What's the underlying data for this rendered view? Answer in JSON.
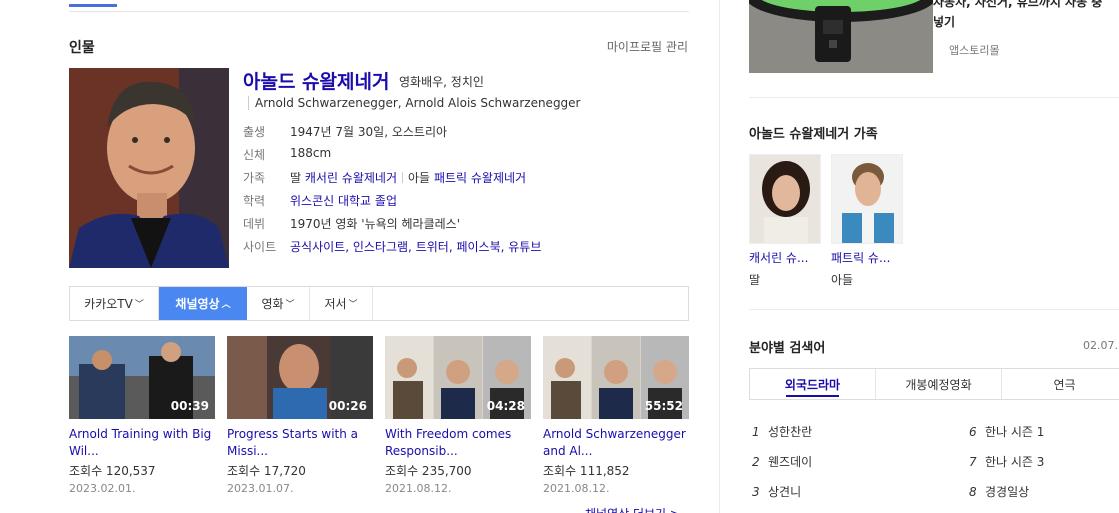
{
  "person": {
    "section_title": "인물",
    "manage_link": "마이프로필 관리",
    "name": "아놀드 슈왈제네거",
    "roles": "영화배우, 정치인",
    "alias": "Arnold Schwarzenegger, Arnold Alois Schwarzenegger",
    "info": {
      "birth_label": "출생",
      "birth_value": "1947년 7월 30일, 오스트리아",
      "height_label": "신체",
      "height_value": "188cm",
      "family_label": "가족",
      "family_daughter_prefix": "딸",
      "family_daughter": "캐서린 슈왈제네거",
      "family_son_prefix": "아들",
      "family_son": "패트릭 슈왈제네거",
      "edu_label": "학력",
      "edu_value": "위스콘신 대학교 졸업",
      "debut_label": "데뷔",
      "debut_value": "1970년 영화 '뉴욕의 헤라클레스'",
      "site_label": "사이트",
      "sites": [
        "공식사이트",
        "인스타그램",
        "트위터",
        "페이스북",
        "유튜브"
      ]
    }
  },
  "tabs": [
    {
      "label": "카카오TV",
      "chevron": "﹀"
    },
    {
      "label": "채널영상",
      "chevron": "︿"
    },
    {
      "label": "영화",
      "chevron": "﹀"
    },
    {
      "label": "저서",
      "chevron": "﹀"
    }
  ],
  "videos": [
    {
      "title": "Arnold Training with Big Wil...",
      "views": "조회수 120,537",
      "date": "2023.02.01.",
      "duration": "00:39"
    },
    {
      "title": "Progress Starts with a Missi...",
      "views": "조회수 17,720",
      "date": "2023.01.07.",
      "duration": "00:26"
    },
    {
      "title": "With Freedom comes Responsib...",
      "views": "조회수 235,700",
      "date": "2021.08.12.",
      "duration": "04:28"
    },
    {
      "title": "Arnold Schwarzenegger and Al...",
      "views": "조회수 111,852",
      "date": "2021.08.12.",
      "duration": "55:52"
    }
  ],
  "more_videos": "채널영상 더보기 >",
  "ad": {
    "text_line1": "자동차, 자전거, 휴브까지 자동 충",
    "text_line2": "넣기",
    "source": "앱스토리몰"
  },
  "family": {
    "title": "아놀드 슈왈제네거 가족",
    "members": [
      {
        "name": "캐서린 슈...",
        "relation": "딸"
      },
      {
        "name": "패트릭 슈...",
        "relation": "아들"
      }
    ]
  },
  "keywords": {
    "title": "분야별 검색어",
    "date": "02.07.",
    "tabs": [
      "외국드라마",
      "개봉예정영화",
      "연극"
    ],
    "items": [
      {
        "rank": "1",
        "label": "성한찬란"
      },
      {
        "rank": "2",
        "label": "웬즈데이"
      },
      {
        "rank": "3",
        "label": "상견니"
      },
      {
        "rank": "6",
        "label": "한나 시즌 1"
      },
      {
        "rank": "7",
        "label": "한나 시즌 3"
      },
      {
        "rank": "8",
        "label": "경경일상"
      }
    ]
  },
  "colors": {
    "accent": "#4a87f0",
    "link": "#1a0dab"
  }
}
